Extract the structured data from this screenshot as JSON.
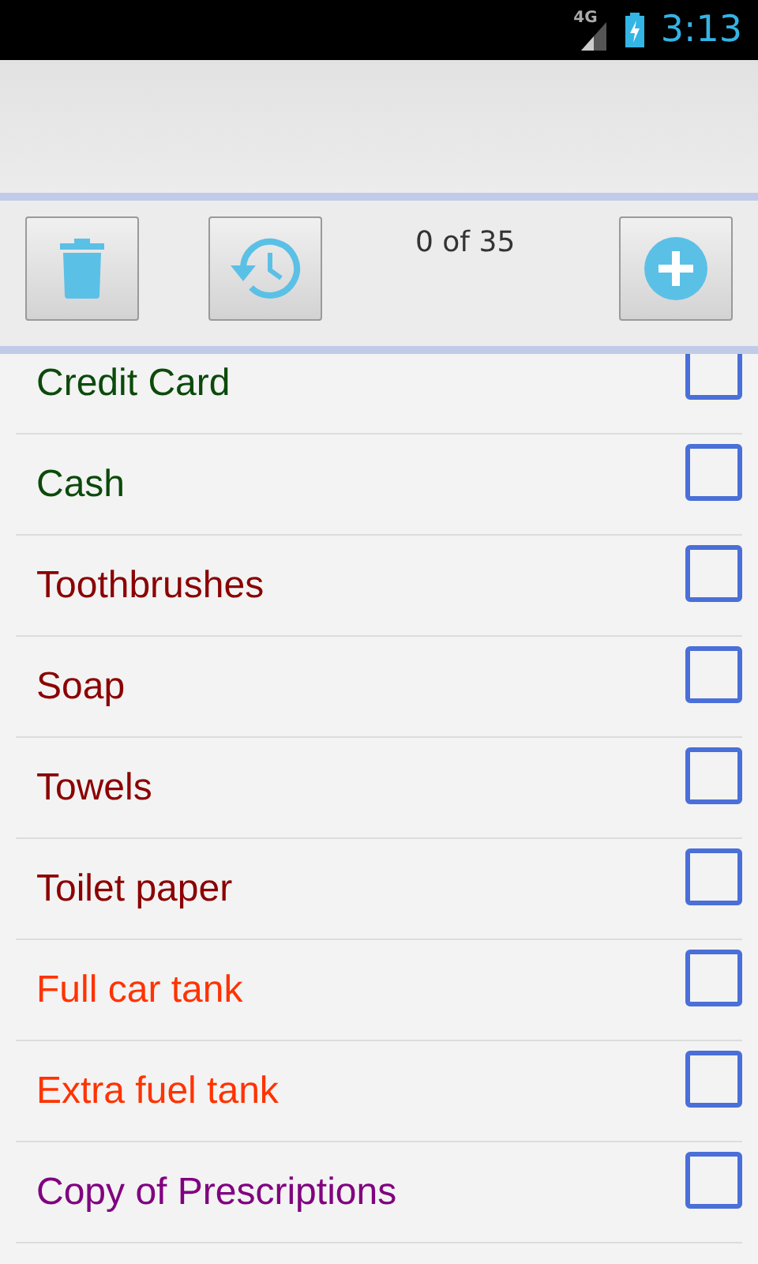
{
  "status_bar": {
    "network": "4G",
    "time": "3:13"
  },
  "toolbar": {
    "counter": "0 of 35"
  },
  "items": [
    {
      "label": "Credit Card",
      "color": "#0b4a0b",
      "checked": false
    },
    {
      "label": "Cash",
      "color": "#0b4a0b",
      "checked": false
    },
    {
      "label": "Toothbrushes",
      "color": "#8b0000",
      "checked": false
    },
    {
      "label": "Soap",
      "color": "#8b0000",
      "checked": false
    },
    {
      "label": "Towels",
      "color": "#8b0000",
      "checked": false
    },
    {
      "label": "Toilet paper",
      "color": "#8b0000",
      "checked": false
    },
    {
      "label": "Full car tank",
      "color": "#ff3300",
      "checked": false
    },
    {
      "label": "Extra fuel tank",
      "color": "#ff3300",
      "checked": false
    },
    {
      "label": "Copy of Prescriptions",
      "color": "#800080",
      "checked": false
    }
  ]
}
